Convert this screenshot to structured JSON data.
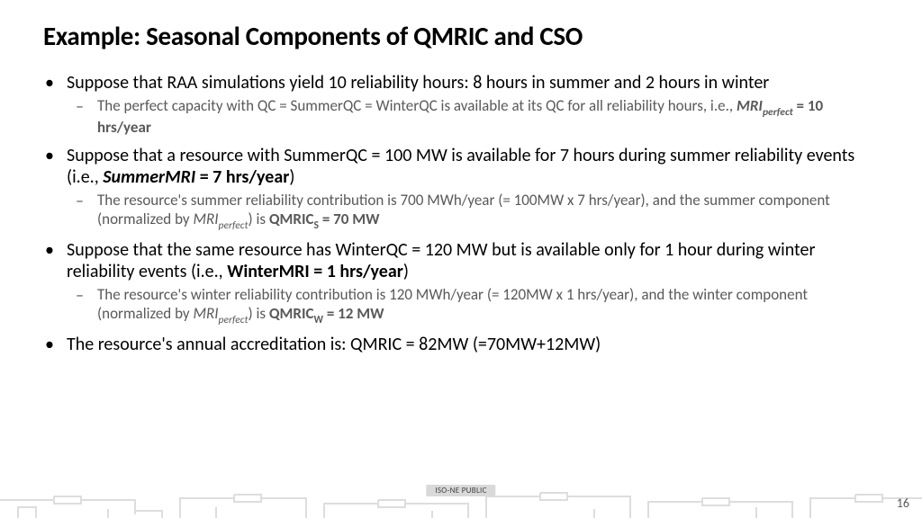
{
  "title": "Example: Seasonal Components of QMRIC and CSO",
  "bullets": {
    "b1": "Suppose that RAA simulations yield 10 reliability hours: 8 hours in summer and 2 hours in winter",
    "b1s_pre": "The perfect capacity with QC = SummerQC = WinterQC is available at its QC for all reliability hours, i.e., ",
    "b1s_bold1": "MRI",
    "b1s_sub1": "perfect",
    "b1s_bold2": " = 10 hrs/year",
    "b2_pre": "Suppose that a resource with SummerQC = 100 MW is available for 7 hours during summer reliability events (i.e., ",
    "b2_bold": "SummerMRI",
    "b2_bold2": " = 7 hrs/year",
    "b2_post": ")",
    "b2s_pre": "The resource's summer reliability contribution is 700 MWh/year (= 100MW x 7 hrs/year), and the summer component (normalized by ",
    "b2s_ital": "MRI",
    "b2s_sub": "perfect",
    "b2s_mid": ") is ",
    "b2s_bold": "QMRIC",
    "b2s_boldsub": "S",
    "b2s_bold2": " = 70 MW",
    "b3_pre": "Suppose that the same resource has WinterQC = 120 MW but is available only for 1 hour during winter reliability events (i.e., ",
    "b3_bold": "WinterMRI = 1 hrs/year",
    "b3_post": ")",
    "b3s_pre": "The resource's winter reliability contribution is 120 MWh/year (= 120MW x 1 hrs/year), and the winter component (normalized by ",
    "b3s_ital": "MRI",
    "b3s_sub": "perfect",
    "b3s_mid": ") is ",
    "b3s_bold": "QMRIC",
    "b3s_boldsub": "W",
    "b3s_bold2": " = 12 MW",
    "b4": "The resource's annual accreditation is: QMRIC = 82MW (=70MW+12MW)"
  },
  "footer": {
    "label": "ISO-NE PUBLIC",
    "page": "16"
  }
}
